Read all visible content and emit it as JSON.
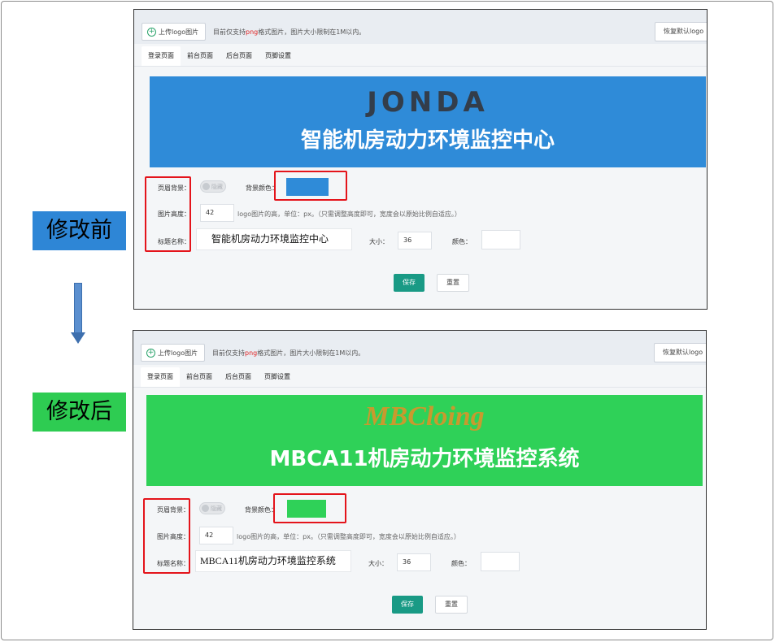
{
  "labels": {
    "before": "修改前",
    "after": "修改后"
  },
  "colors": {
    "before_banner": "#2f8bd8",
    "after_banner": "#2fd158",
    "annotation": "#e4141b",
    "save_button": "#199a85"
  },
  "toolbar": {
    "upload_label": "上传logo图片",
    "note_prefix": "目前仅支持",
    "note_highlight": "png",
    "note_suffix": "格式图片，图片大小限制在1M以内。",
    "restore_label": "恢复默认logo"
  },
  "tabs": [
    "登录页面",
    "前台页面",
    "后台页面",
    "页脚设置"
  ],
  "form": {
    "header_bg_label": "页眉背景：",
    "toggle_text": "隐藏",
    "bg_color_label": "背景颜色：",
    "image_height_label": "图片高度：",
    "image_height_value": "42",
    "image_height_hint": "logo图片的高，单位：px。（只需调整高度即可，宽度会以原始比例自适应。）",
    "title_label": "标题名称：",
    "size_label": "大小：",
    "size_value": "36",
    "color_label": "颜色：",
    "save_label": "保存",
    "reset_label": "重置"
  },
  "before": {
    "logo": "JONDA",
    "banner_title": "智能机房动力环境监控中心",
    "title_value": "智能机房动力环境监控中心"
  },
  "after": {
    "logo": "MBCloing",
    "banner_title": "MBCA11机房动力环境监控系统",
    "title_value": "MBCA11机房动力环境监控系统"
  }
}
